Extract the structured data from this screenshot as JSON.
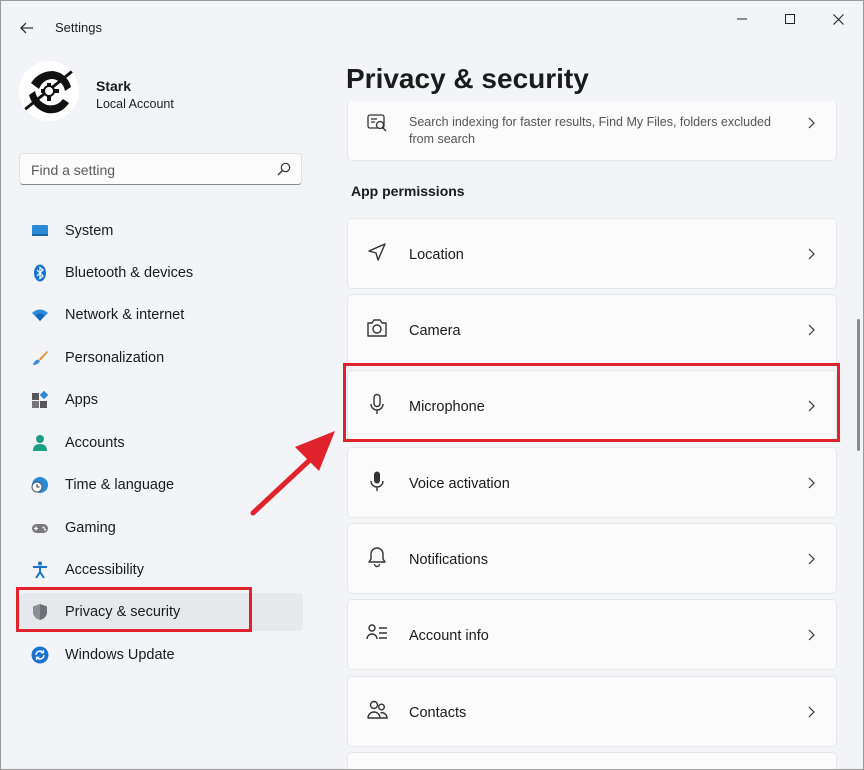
{
  "app": {
    "title": "Settings"
  },
  "profile": {
    "name": "Stark",
    "account_type": "Local Account"
  },
  "search": {
    "placeholder": "Find a setting"
  },
  "sidebar": {
    "items": [
      {
        "label": "System",
        "icon": "system-icon"
      },
      {
        "label": "Bluetooth & devices",
        "icon": "bluetooth-icon"
      },
      {
        "label": "Network & internet",
        "icon": "wifi-icon"
      },
      {
        "label": "Personalization",
        "icon": "brush-icon"
      },
      {
        "label": "Apps",
        "icon": "apps-icon"
      },
      {
        "label": "Accounts",
        "icon": "person-icon"
      },
      {
        "label": "Time & language",
        "icon": "globe-clock-icon"
      },
      {
        "label": "Gaming",
        "icon": "gamepad-icon"
      },
      {
        "label": "Accessibility",
        "icon": "accessibility-icon"
      },
      {
        "label": "Privacy & security",
        "icon": "shield-icon",
        "selected": true
      },
      {
        "label": "Windows Update",
        "icon": "update-icon"
      }
    ]
  },
  "main": {
    "title": "Privacy & security",
    "search_card": {
      "description": "Search indexing for faster results, Find My Files, folders excluded from search"
    },
    "section": "App permissions",
    "permissions": [
      {
        "label": "Location",
        "icon": "location-icon"
      },
      {
        "label": "Camera",
        "icon": "camera-icon"
      },
      {
        "label": "Microphone",
        "icon": "microphone-icon",
        "highlighted": true
      },
      {
        "label": "Voice activation",
        "icon": "voice-icon"
      },
      {
        "label": "Notifications",
        "icon": "bell-icon"
      },
      {
        "label": "Account info",
        "icon": "account-info-icon"
      },
      {
        "label": "Contacts",
        "icon": "contacts-icon"
      }
    ]
  },
  "colors": {
    "highlight": "#e0222c",
    "accent": "#0067c0",
    "selected_bg": "#e7e8eb"
  }
}
